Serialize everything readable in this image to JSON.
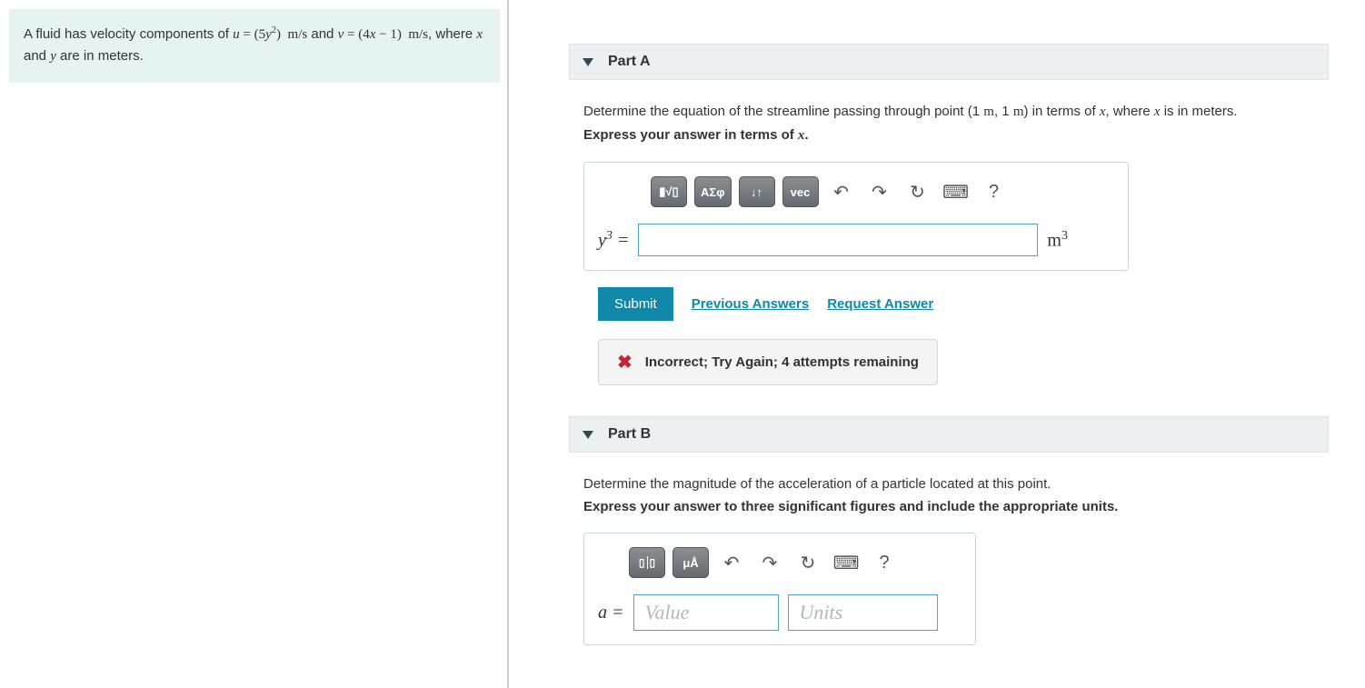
{
  "question_html": "A fluid has velocity components of <span style=\"font-family:'Times New Roman',serif;\"><i>u</i> = (5<i>y</i><sup>2</sup>)&nbsp; m/s</span> and <span style=\"font-family:'Times New Roman',serif;\"><i>v</i> = (4<i>x</i> − 1)&nbsp; m/s</span>, where <span style=\"font-family:'Times New Roman',serif;\"><i>x</i></span> and <span style=\"font-family:'Times New Roman',serif;\"><i>y</i></span> are in meters.",
  "partA": {
    "title": "Part A",
    "instr_html": "Determine the equation of the streamline passing through point (1 <span style='font-family:Times New Roman,serif'>m</span>, 1 <span style='font-family:Times New Roman,serif'>m</span>) in terms of <span style='font-family:Times New Roman,serif;font-style:italic'>x</span>, where <span style='font-family:Times New Roman,serif;font-style:italic'>x</span> is in meters.",
    "express_html": "Express your answer in terms of <span style='font-family:Times New Roman,serif;font-style:italic'>x</span>.",
    "toolbar": {
      "templates": "▮√▯",
      "greek": "ΑΣφ",
      "subsup": "↓↑",
      "vec": "vec"
    },
    "lhs_html": "<i>y</i><sup>3</sup> =",
    "unit_html": "m<sup>3</sup>",
    "submit": "Submit",
    "prev": "Previous Answers",
    "req": "Request Answer",
    "feedback": "Incorrect; Try Again; 4 attempts remaining"
  },
  "partB": {
    "title": "Part B",
    "instr": "Determine the magnitude of the acceleration of a particle located at this point.",
    "express": "Express your answer to three significant figures and include the appropriate units.",
    "toolbar": {
      "units": "μÅ"
    },
    "lhs_html": "<i>a</i> =",
    "value_ph": "Value",
    "units_ph": "Units"
  }
}
